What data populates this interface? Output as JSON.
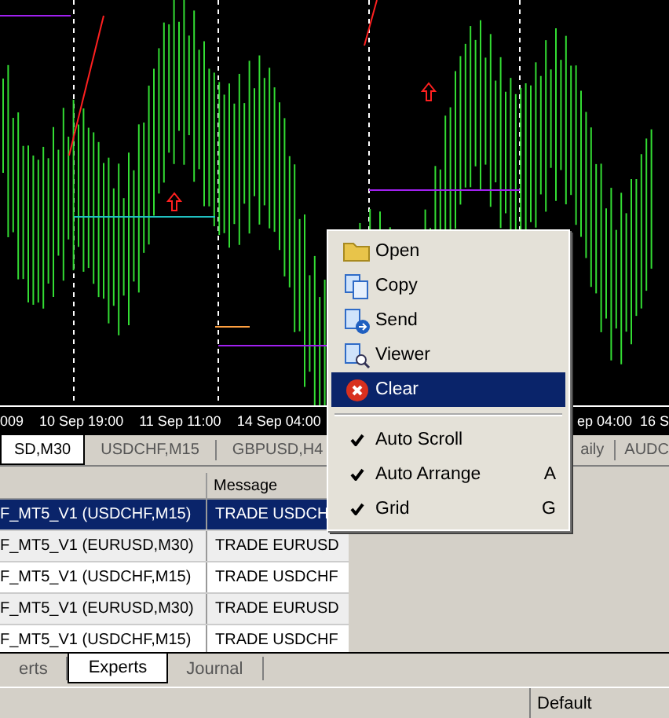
{
  "chart": {
    "time_axis_left": [
      "009",
      "10 Sep 19:00",
      "11 Sep 11:00",
      "14 Sep 04:00"
    ],
    "time_axis_right": [
      "ep 04:00",
      "16 S"
    ]
  },
  "chart_tabs_left": [
    {
      "label": "SD,M30",
      "selected": true
    },
    {
      "label": "USDCHF,M15",
      "selected": false
    },
    {
      "label": "GBPUSD,H4",
      "selected": false
    }
  ],
  "chart_tabs_right": [
    {
      "label": "aily",
      "selected": false
    },
    {
      "label": "AUDC",
      "selected": false
    }
  ],
  "table": {
    "columns": [
      "",
      "Message"
    ],
    "rows": [
      {
        "cells": [
          "F_MT5_V1 (USDCHF,M15)",
          "TRADE USDCH"
        ],
        "selected": true
      },
      {
        "cells": [
          "F_MT5_V1 (EURUSD,M30)",
          "TRADE EURUSD"
        ],
        "selected": false
      },
      {
        "cells": [
          "F_MT5_V1 (USDCHF,M15)",
          "TRADE USDCHF"
        ],
        "selected": false
      },
      {
        "cells": [
          "F_MT5_V1 (EURUSD,M30)",
          "TRADE EURUSD"
        ],
        "selected": false
      },
      {
        "cells": [
          "F_MT5_V1 (USDCHF,M15)",
          "TRADE USDCHF"
        ],
        "selected": false
      }
    ]
  },
  "bottom_tabs": [
    {
      "label": "erts",
      "selected": false
    },
    {
      "label": "Experts",
      "selected": true
    },
    {
      "label": "Journal",
      "selected": false
    }
  ],
  "status_bar": {
    "profile": "Default"
  },
  "context_menu": {
    "items": [
      {
        "kind": "command",
        "label": "Open",
        "selected": false
      },
      {
        "kind": "command",
        "label": "Copy",
        "selected": false
      },
      {
        "kind": "command",
        "label": "Send",
        "selected": false
      },
      {
        "kind": "command",
        "label": "Viewer",
        "selected": false
      },
      {
        "kind": "command",
        "label": "Clear",
        "selected": true
      },
      {
        "kind": "separator"
      },
      {
        "kind": "toggle",
        "label": "Auto Scroll",
        "checked": true
      },
      {
        "kind": "toggle",
        "label": "Auto Arrange",
        "checked": true,
        "shortcut": "A"
      },
      {
        "kind": "toggle",
        "label": "Grid",
        "checked": true,
        "shortcut": "G"
      }
    ]
  }
}
